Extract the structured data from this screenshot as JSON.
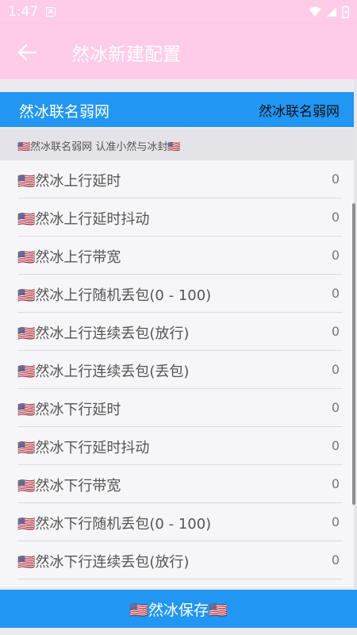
{
  "status_bar": {
    "time": "1:47",
    "notification_glyph": "A",
    "icons": [
      "wifi-icon",
      "signal-icon",
      "battery-icon"
    ]
  },
  "app_bar": {
    "title": "然冰新建配置",
    "back_icon": "arrow-back-icon"
  },
  "header": {
    "left_text": "然冰联名弱网",
    "right_text": "然冰联名弱网"
  },
  "subheader": {
    "text": "🇺🇸然冰联名弱网 认准小然与冰封🇺🇸"
  },
  "rows": [
    {
      "label": "🇺🇸然冰上行延时",
      "value": "0"
    },
    {
      "label": "🇺🇸然冰上行延时抖动",
      "value": "0"
    },
    {
      "label": "🇺🇸然冰上行带宽",
      "value": "0"
    },
    {
      "label": "🇺🇸然冰上行随机丢包(0 - 100)",
      "value": "0"
    },
    {
      "label": "🇺🇸然冰上行连续丢包(放行)",
      "value": "0"
    },
    {
      "label": "🇺🇸然冰上行连续丢包(丢包)",
      "value": "0"
    },
    {
      "label": "🇺🇸然冰下行延时",
      "value": "0"
    },
    {
      "label": "🇺🇸然冰下行延时抖动",
      "value": "0"
    },
    {
      "label": "🇺🇸然冰下行带宽",
      "value": "0"
    },
    {
      "label": "🇺🇸然冰下行随机丢包(0 - 100)",
      "value": "0"
    },
    {
      "label": "🇺🇸然冰下行连续丢包(放行)",
      "value": "0"
    }
  ],
  "save_button": {
    "label": "🇺🇸然冰保存🇺🇸"
  },
  "colors": {
    "app_bar": "#ffcce8",
    "accent": "#2196f3",
    "list_bg": "#f6f6f8"
  }
}
